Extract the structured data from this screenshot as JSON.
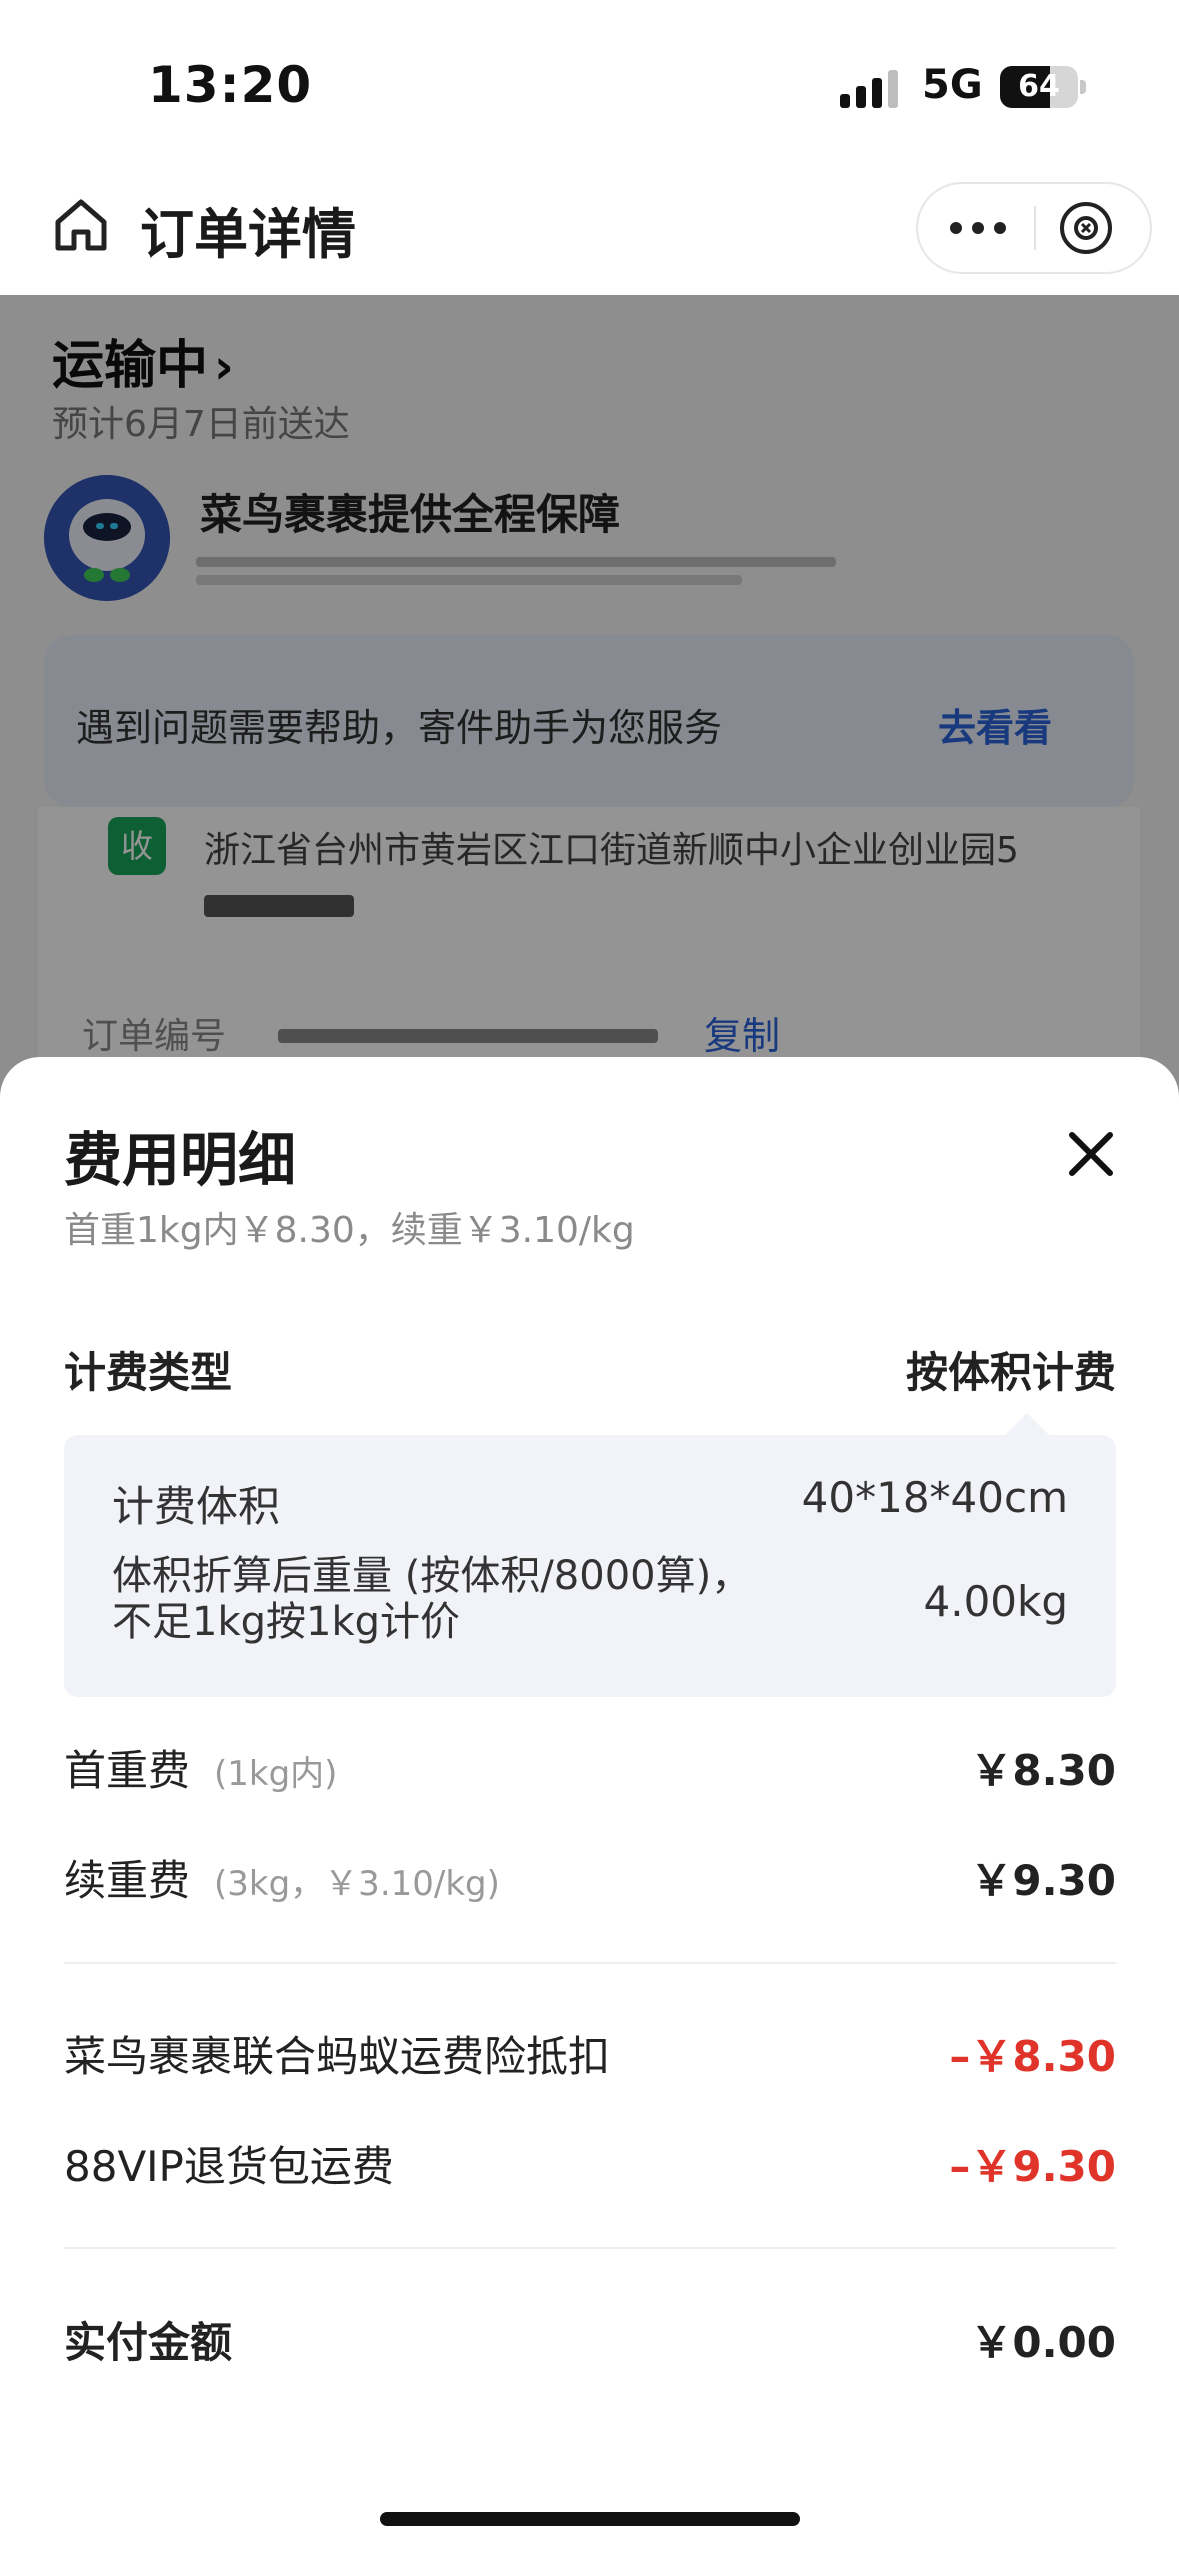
{
  "status_bar": {
    "time": "13:20",
    "network": "5G",
    "battery": "64",
    "battery_level": 0.64
  },
  "nav": {
    "title": "订单详情"
  },
  "page": {
    "shipping_status": "运输中",
    "eta": "预计6月7日前送达",
    "guarantee": "菜鸟裹裹提供全程保障",
    "help_text": "遇到问题需要帮助，寄件助手为您服务",
    "help_link": "去看看",
    "address_badge": "收",
    "address": "浙江省台州市黄岩区江口街道新顺中小企业创业园5",
    "order_label": "订单编号",
    "copy_label": "复制"
  },
  "sheet": {
    "title": "费用明细",
    "subtitle": "首重1kg内￥8.30，续重￥3.10/kg",
    "billing_type_label": "计费类型",
    "billing_type_value": "按体积计费",
    "volume_label": "计费体积",
    "volume_value": "40*18*40cm",
    "converted_label": "体积折算后重量 (按体积/8000算)，不足1kg按1kg计价",
    "converted_value": "4.00kg",
    "first_weight_label": "首重费",
    "first_weight_note": "(1kg内)",
    "first_weight_value": "￥8.30",
    "extra_weight_label": "续重费",
    "extra_weight_note": "(3kg，￥3.10/kg)",
    "extra_weight_value": "￥9.30",
    "insurance_label": "菜鸟裹裹联合蚂蚁运费险抵扣",
    "insurance_value": "–￥8.30",
    "vip_label": "88VIP退货包运费",
    "vip_value": "–￥9.30",
    "total_label": "实付金额",
    "total_value": "￥0.00"
  }
}
